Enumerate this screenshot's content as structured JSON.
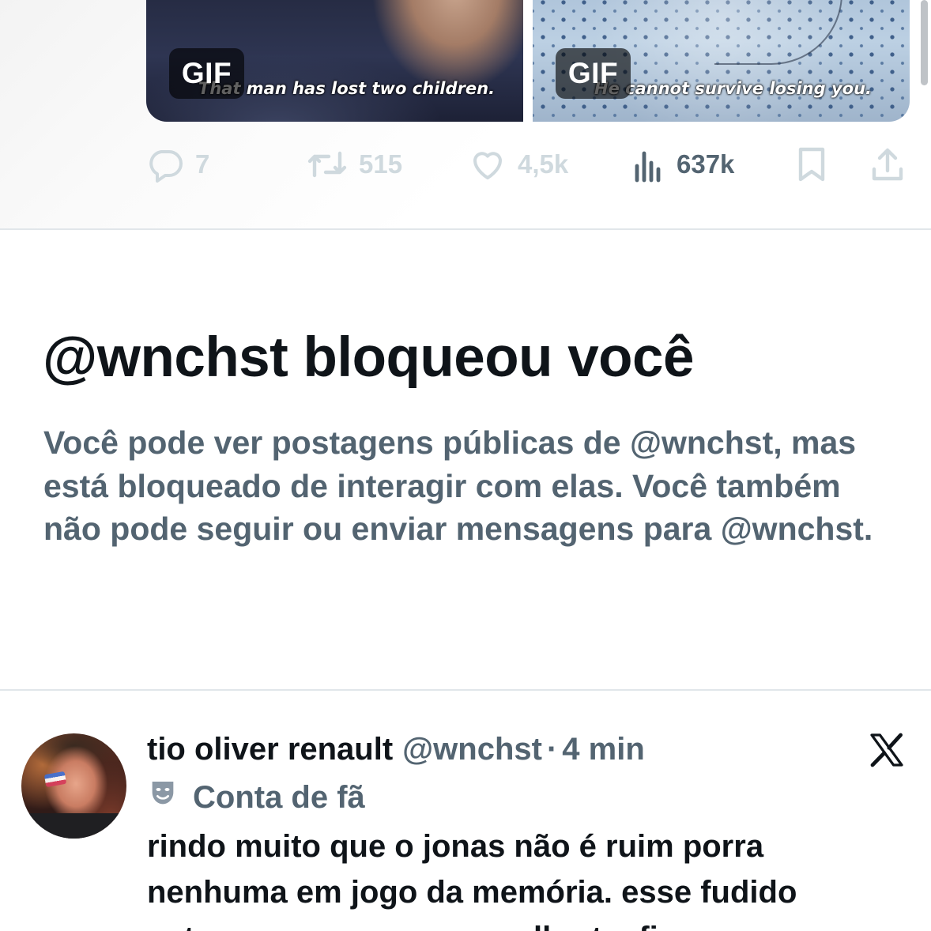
{
  "top_tweet": {
    "media": [
      {
        "badge": "GIF",
        "caption": "That man has lost two children."
      },
      {
        "badge": "GIF",
        "caption": "He cannot survive losing you."
      }
    ],
    "actions": {
      "reply_count": "7",
      "retweet_count": "515",
      "like_count": "4,5k",
      "view_count": "637k"
    },
    "icons": [
      "reply-icon",
      "retweet-icon",
      "like-icon",
      "views-icon",
      "bookmark-icon",
      "share-icon"
    ]
  },
  "block_notice": {
    "title": "@wnchst bloqueou você",
    "body": "Você pode ver postagens públicas de @wnchst, mas está bloqueado de interagir com elas. Você também não pode seguir ou enviar mensagens para @wnchst."
  },
  "quoted_tweet": {
    "display_name": "tio oliver renault",
    "handle": "@wnchst",
    "separator": "·",
    "time": "4 min",
    "label": "Conta de fã",
    "text": "rindo muito que o jonas não é ruim porra nenhuma em jogo da memória. esse fudido entregou a prova para o alberto. ficou",
    "platform_icon": "x-logo-icon"
  },
  "colors": {
    "text_primary": "#0f1419",
    "text_secondary": "#536471",
    "icon_muted": "#cfd9de",
    "divider": "#e1e6ea"
  }
}
